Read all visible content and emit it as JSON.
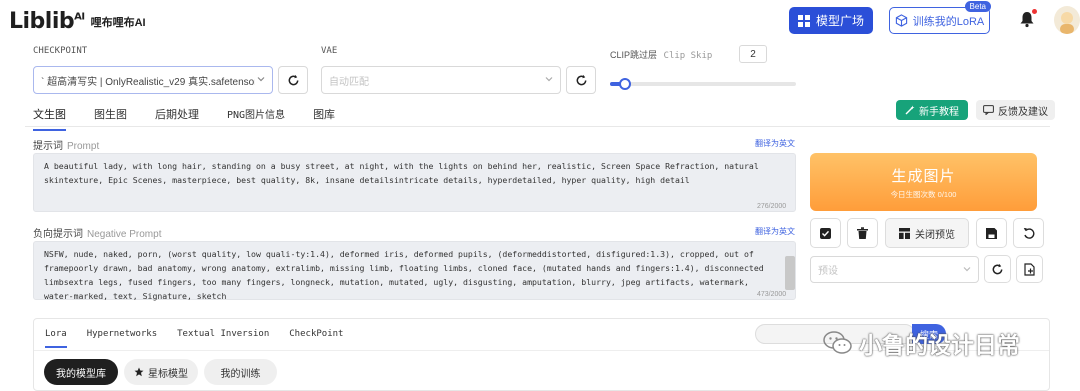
{
  "header": {
    "logo_text": "Liblib",
    "logo_ai": "AI",
    "logo_sub": "哩布哩布AI",
    "models_button": "模型广场",
    "train_button": "训练我的LoRA",
    "beta_badge": "Beta"
  },
  "params": {
    "checkpoint_label": "CHECKPOINT",
    "checkpoint_value": "` 超高清写实 | OnlyRealistic_v29 真实.safetensors",
    "vae_label": "VAE",
    "vae_placeholder": "自动匹配",
    "clip_label": "CLIP跳过层",
    "clip_label_en": "Clip Skip",
    "clip_value": "2",
    "clip_slider_fraction": 0.08
  },
  "tabs": [
    "文生图",
    "图生图",
    "后期处理",
    "PNG图片信息",
    "图库"
  ],
  "actions": {
    "tutorial": "新手教程",
    "feedback": "反馈及建议"
  },
  "prompt": {
    "label": "提示词",
    "label_en": "Prompt",
    "translate": "翻译为英文",
    "text": "A beautiful lady, with long hair, standing on a busy street, at night, with the lights on behind her, realistic, Screen Space Refraction, natural skintexture, Epic Scenes, masterpiece, best quality, 8k, insane detailsintricate details, hyperdetailed, hyper quality, high detail",
    "count": "276/2000"
  },
  "negative": {
    "label": "负向提示词",
    "label_en": "Negative Prompt",
    "translate": "翻译为英文",
    "text": "NSFW, nude, naked, porn, (worst quality, low quali-ty:1.4), deformed iris, deformed pupils, (deformeddistorted, disfigured:1.3), cropped, out of framepoorly drawn, bad anatomy, wrong anatomy, extralimb, missing limb, floating limbs, cloned face, (mutated hands and fingers:1.4), disconnected limbsextra legs, fused fingers, too many fingers, longneck, mutation, mutated, ugly, disgusting, amputation, blurry, jpeg artifacts, watermark, water-marked, text, Signature, sketch",
    "count": "473/2000"
  },
  "generate": {
    "title": "生成图片",
    "subtitle": "今日生图次数 0/100"
  },
  "preview": {
    "close_label": "关闭预览",
    "preset_placeholder": "预设"
  },
  "lower": {
    "tabs": [
      "Lora",
      "Hypernetworks",
      "Textual Inversion",
      "CheckPoint"
    ],
    "search_button": "搜索",
    "chips": [
      "我的模型库",
      "星标模型",
      "我的训练"
    ]
  },
  "watermark": "小鲁的设计日常",
  "colors": {
    "accent": "#3f63e0",
    "generate": "#ffab4a",
    "green": "#17a37a"
  }
}
